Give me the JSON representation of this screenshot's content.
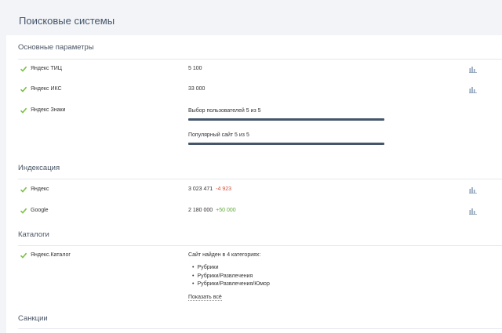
{
  "page": {
    "title": "Поисковые системы"
  },
  "sections": {
    "main": {
      "title": "Основные параметры",
      "tic": {
        "label": "Яндекс ТИЦ",
        "value": "5 100"
      },
      "iks": {
        "label": "Яндекс ИКС",
        "value": "33 000"
      },
      "znaki": {
        "label": "Яндекс Знаки",
        "badges": [
          {
            "label": "Выбор пользователей 5 из 5",
            "fraction": 1.0
          },
          {
            "label": "Популярный сайт 5 из 5",
            "fraction": 1.0
          }
        ]
      }
    },
    "index": {
      "title": "Индексация",
      "yandex": {
        "label": "Яндекс",
        "value": "3 023 471",
        "delta": "-4 923"
      },
      "google": {
        "label": "Google",
        "value": "2 180 000",
        "delta": "+50 000"
      }
    },
    "catalogs": {
      "title": "Каталоги",
      "yandex_catalog": {
        "label": "Яндекс.Каталог",
        "summary": "Сайт найден в 4 категориях:",
        "categories": [
          "Рубрики",
          "Рубрики/Развлечения",
          "Рубрики/Развлечения/Юмор"
        ],
        "show_all": "Показать всё"
      }
    },
    "sanctions": {
      "title": "Санкции"
    }
  },
  "colors": {
    "check": "#7cc04a",
    "progress": "#44566c",
    "negative": "#d0503e",
    "positive": "#5cab34",
    "icon": "#8ea2b8"
  },
  "icons": {
    "status": "check-icon",
    "chart": "bar-chart-icon"
  }
}
